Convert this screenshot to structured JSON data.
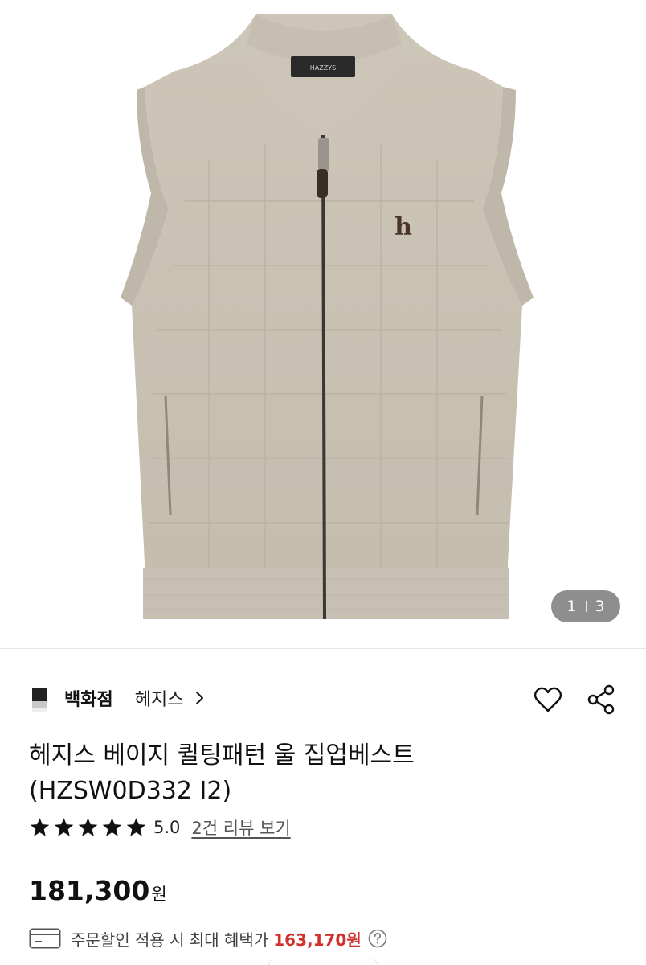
{
  "product_image": {
    "label_text": "HAZZYS",
    "emblem_letter": "h"
  },
  "pager": {
    "current": "1",
    "total": "3"
  },
  "brand": {
    "store": "백화점",
    "brand_name": "헤지스"
  },
  "product": {
    "title_line1": "헤지스 베이지 퀼팅패턴 울 집업베스트",
    "title_line2": "(HZSW0D332 I2)"
  },
  "rating": {
    "stars": 5,
    "score": "5.0",
    "review_link": "2건 리뷰 보기"
  },
  "price": {
    "amount": "181,300",
    "unit": "원"
  },
  "benefit": {
    "text": "주문할인 적용 시 최대 혜택가",
    "price": "163,170원",
    "accent_color": "#d0312d"
  },
  "icons": [
    "heart-icon",
    "share-icon",
    "chevron-right-icon",
    "star-icon",
    "card-icon",
    "question-icon"
  ]
}
